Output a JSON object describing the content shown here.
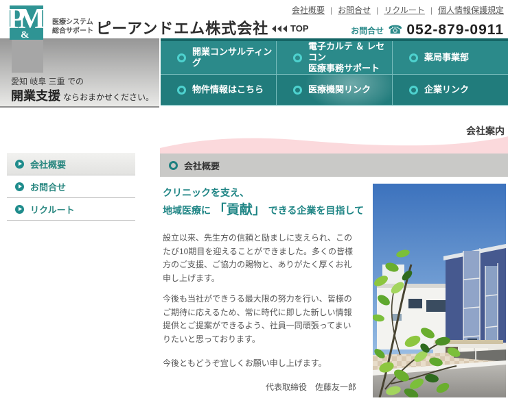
{
  "top_links": [
    "会社概要",
    "お問合せ",
    "リクルート",
    "個人情報保護規定"
  ],
  "header": {
    "logo_p": "P",
    "logo_amp": "&",
    "logo_m": "M",
    "tagline_line1": "医療システム",
    "tagline_line2": "総合サポート",
    "company_name": "ピーアンドエム株式会社",
    "top_button_label": "TOP",
    "contact_label": "お問合せ",
    "phone_glyph": "☎",
    "phone_number": "052-879-0911"
  },
  "hero": {
    "region_text": "愛知 岐阜 三重 での",
    "support_strong": "開業支援",
    "support_rest": "ならおまかせください。"
  },
  "nav_items": [
    {
      "label": "開業コンサルティング"
    },
    {
      "label": "電子カルテ ＆ レセコン",
      "label2": "医療事務サポート"
    },
    {
      "label": "薬局事業部"
    },
    {
      "label": "物件情報はこちら"
    },
    {
      "label": "医療機関リンク"
    },
    {
      "label": "企業リンク"
    }
  ],
  "page": {
    "breadcrumb": "会社案内"
  },
  "sidebar": {
    "items": [
      {
        "label": "会社概要"
      },
      {
        "label": "お問合せ"
      },
      {
        "label": "リクルート"
      }
    ]
  },
  "main": {
    "section_title": "会社概要",
    "heading_line1": "クリニックを支え、",
    "heading_line2_pre": "地域医療に",
    "heading_line2_em": "「貢献」",
    "heading_line2_post": "できる企業を目指して",
    "paragraph1": "設立以来、先生方の信頼と励ましに支えられ、このたび10期目を迎えることができました。多くの皆様方のご支援、ご協力の賜物と、ありがたく厚くお礼申し上げます。",
    "paragraph2": "今後も当社ができうる最大限の努力を行い、皆様のご期待に応えるため、常に時代に即した新しい情報提供とご提案ができるよう、社員一同頑張ってまいりたいと思っております。",
    "paragraph3": "今後ともどうぞ宜しくお願い申し上げます。",
    "signature": "代表取締役　佐藤友一郎"
  },
  "colors": {
    "brand_teal": "#2a8a8a",
    "nav_row1": "#2b8a8a",
    "nav_row2": "#217c7c",
    "nav_ring": "#4ed2cf",
    "pink_wave": "#fbd9dc",
    "section_bar_gray": "#c9c9c7",
    "heading_teal": "#1f8585"
  }
}
